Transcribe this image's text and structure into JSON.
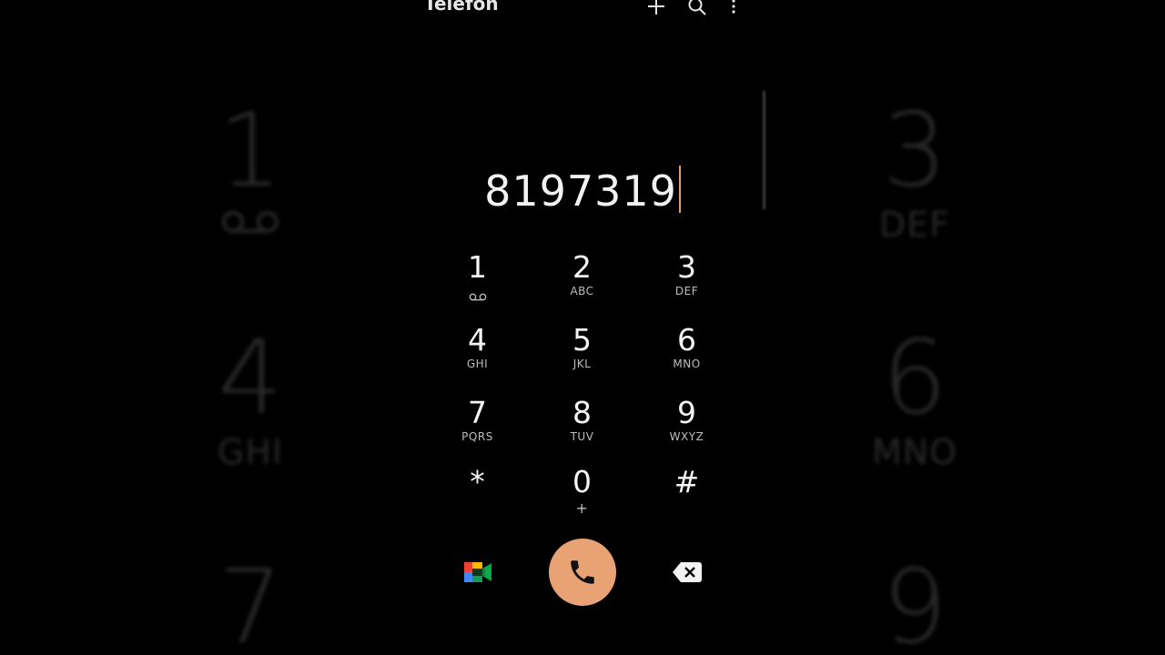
{
  "app": {
    "title": "Telefon",
    "add_icon": "plus-icon",
    "search_icon": "search-icon",
    "more_icon": "more-vertical-icon"
  },
  "dialer": {
    "number": "8197319"
  },
  "keypad": {
    "keys": [
      {
        "digit": "1",
        "letters": "",
        "icon": "voicemail-icon"
      },
      {
        "digit": "2",
        "letters": "ABC"
      },
      {
        "digit": "3",
        "letters": "DEF"
      },
      {
        "digit": "4",
        "letters": "GHI"
      },
      {
        "digit": "5",
        "letters": "JKL"
      },
      {
        "digit": "6",
        "letters": "MNO"
      },
      {
        "digit": "7",
        "letters": "PQRS"
      },
      {
        "digit": "8",
        "letters": "TUV"
      },
      {
        "digit": "9",
        "letters": "WXYZ"
      },
      {
        "digit": "*",
        "letters": ""
      },
      {
        "digit": "0",
        "letters": "+"
      },
      {
        "digit": "#",
        "letters": ""
      }
    ]
  },
  "actions": {
    "video_call_icon": "google-meet-icon",
    "call_icon": "phone-icon",
    "backspace_icon": "backspace-icon"
  },
  "background": {
    "keys": [
      {
        "digit": "1",
        "letters": ""
      },
      {
        "digit": "3",
        "letters": "DEF"
      },
      {
        "digit": "4",
        "letters": "GHI"
      },
      {
        "digit": "6",
        "letters": "MNO"
      },
      {
        "digit": "7",
        "letters": ""
      },
      {
        "digit": "9",
        "letters": ""
      }
    ]
  },
  "colors": {
    "accent": "#e9a273",
    "background": "#000000",
    "text": "#f4f4f4"
  }
}
